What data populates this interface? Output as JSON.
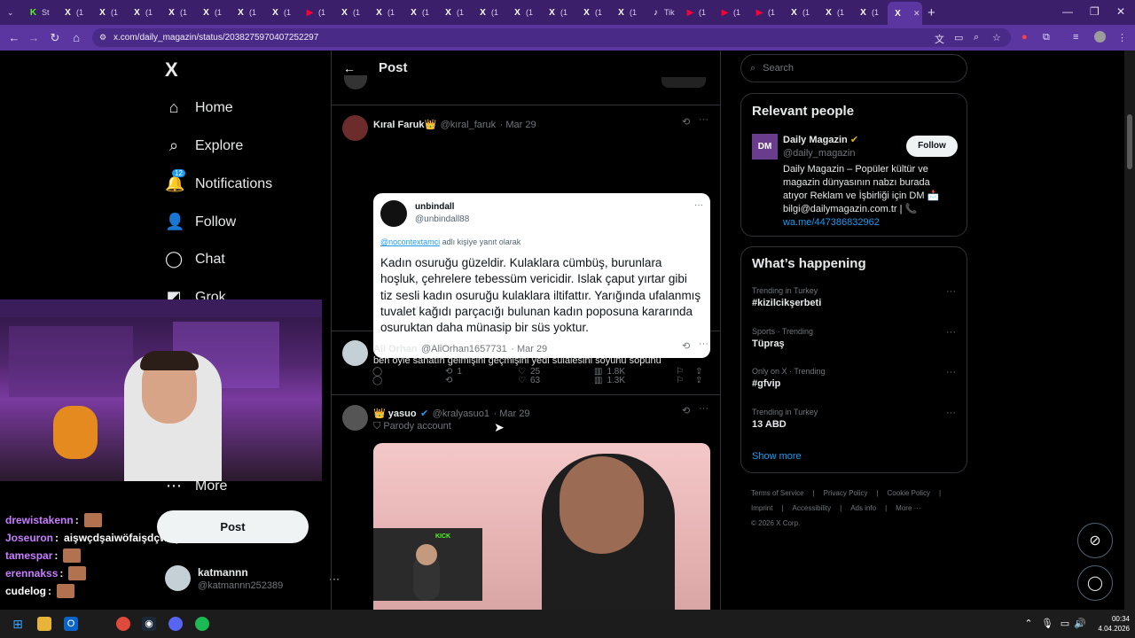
{
  "browser": {
    "tabs": [
      {
        "fav": "K",
        "label": "St",
        "color": "#53fc18"
      },
      {
        "fav": "X",
        "label": "(1"
      },
      {
        "fav": "X",
        "label": "(1"
      },
      {
        "fav": "X",
        "label": "(1"
      },
      {
        "fav": "X",
        "label": "(1"
      },
      {
        "fav": "X",
        "label": "(1"
      },
      {
        "fav": "X",
        "label": "(1"
      },
      {
        "fav": "X",
        "label": "(1"
      },
      {
        "fav": "▶",
        "label": "(1",
        "color": "#ff0033"
      },
      {
        "fav": "X",
        "label": "(1"
      },
      {
        "fav": "X",
        "label": "(1"
      },
      {
        "fav": "X",
        "label": "(1"
      },
      {
        "fav": "X",
        "label": "(1"
      },
      {
        "fav": "X",
        "label": "(1"
      },
      {
        "fav": "X",
        "label": "(1"
      },
      {
        "fav": "X",
        "label": "(1"
      },
      {
        "fav": "X",
        "label": "(1"
      },
      {
        "fav": "X",
        "label": "(1"
      },
      {
        "fav": "♪",
        "label": "Tik"
      },
      {
        "fav": "▶",
        "label": "(1",
        "color": "#ff0033"
      },
      {
        "fav": "▶",
        "label": "(1",
        "color": "#ff0033"
      },
      {
        "fav": "▶",
        "label": "(1",
        "color": "#ff0033"
      },
      {
        "fav": "X",
        "label": "(1"
      },
      {
        "fav": "X",
        "label": "(1"
      },
      {
        "fav": "X",
        "label": "(1"
      },
      {
        "fav": "X",
        "label": "",
        "active": true
      }
    ],
    "url": "x.com/daily_magazin/status/2038275970407252297"
  },
  "nav": {
    "logo": "X",
    "items": [
      {
        "icon": "⌂",
        "label": "Home"
      },
      {
        "icon": "⌕",
        "label": "Explore"
      },
      {
        "icon": "🔔",
        "label": "Notifications",
        "badge": "12"
      },
      {
        "icon": "👤",
        "label": "Follow"
      },
      {
        "icon": "◯",
        "label": "Chat"
      },
      {
        "icon": "◩",
        "label": "Grok"
      },
      {
        "icon": "⋯",
        "label": "More"
      }
    ],
    "post_label": "Post",
    "account": {
      "name": "katmannn",
      "handle": "@katmannn252389",
      "more": "···"
    }
  },
  "chat": [
    {
      "user": "drewistakenn",
      "color": "#c77dff",
      "text": "",
      "emote": true
    },
    {
      "user": "Joseuron",
      "color": "#c77dff",
      "text": "aişwçdşaiwöfaişdçwaşiöf",
      "emote": false
    },
    {
      "user": "tamespar",
      "color": "#c77dff",
      "text": "",
      "emote": true
    },
    {
      "user": "erennakss",
      "color": "#c77dff",
      "text": "",
      "emote": true
    },
    {
      "user": "cudelog",
      "color": "#ffffff",
      "text": "",
      "emote": true
    }
  ],
  "header": {
    "back": "←",
    "title": "Post"
  },
  "tweets": [
    {
      "name": "Kıral Faruk👑",
      "handle": "@kıral_faruk",
      "date": "· Mar 29",
      "quote": {
        "name": "unbindall",
        "handle": "@unbindall88",
        "reply_to": "@nocontextamci",
        "reply_suffix": " adlı kişiye yanıt olarak",
        "text": "Kadın osuruğu güzeldir. Kulaklara cümbüş, burunlara hoşluk, çehrelere tebessüm vericidir. Islak çaput yırtar gibi tiz sesli kadın osuruğu kulaklara iltifattır. Yarığında ufalanmış tuvalet kağıdı parçacığı bulunan kadın poposuna kararında osuruktan daha münasip bir süs yoktur."
      },
      "stats": {
        "replies": "",
        "reposts": "1",
        "likes": "25",
        "views": "1.8K"
      }
    },
    {
      "name": "Ali Orhan",
      "handle": "@AliOrhan1657731",
      "date": "· Mar 29",
      "text": "ben öyle sanatın gelmişini  geçmişini yedi sülalesini soyunu sopunu",
      "stats": {
        "replies": "",
        "reposts": "",
        "likes": "63",
        "views": "1.3K"
      }
    },
    {
      "name": "👑 yasuo",
      "handle": "@kralyasuo1",
      "date": "· Mar 29",
      "parody": "Parody account"
    }
  ],
  "right": {
    "search_placeholder": "Search",
    "relevant": {
      "title": "Relevant people",
      "name": "Daily Magazin",
      "handle": "@daily_magazin",
      "follow": "Follow",
      "avatar": "DM",
      "bio": "Daily Magazin – Popüler kültür ve magazin dünyasının nabzı burada atıyor Reklam ve İşbirliği için DM 📩 bilgi@dailymagazin.com.tr | 📞",
      "link": "wa.me/447386832962"
    },
    "happening": {
      "title": "What’s happening",
      "trends": [
        {
          "context": "Trending in Turkey",
          "title": "#kizilcikşerbeti"
        },
        {
          "context": "Sports · Trending",
          "title": "Tüpraş"
        },
        {
          "context": "Only on X · Trending",
          "title": "#gfvip"
        },
        {
          "context": "Trending in Turkey",
          "title": "13 ABD"
        }
      ],
      "show_more": "Show more"
    },
    "footer": [
      "Terms of Service",
      "|",
      "Privacy Policy",
      "|",
      "Cookie Policy",
      "|",
      "Imprint",
      "|",
      "Accessibility",
      "|",
      "Ads info",
      "|",
      "More ···",
      "© 2026 X Corp."
    ]
  },
  "taskbar": {
    "time": "00:34",
    "date": "4.04.2026"
  },
  "colors": {
    "accent": "#1d9bf0",
    "browser": "#5b35a0",
    "link": "#1d9bf0"
  }
}
